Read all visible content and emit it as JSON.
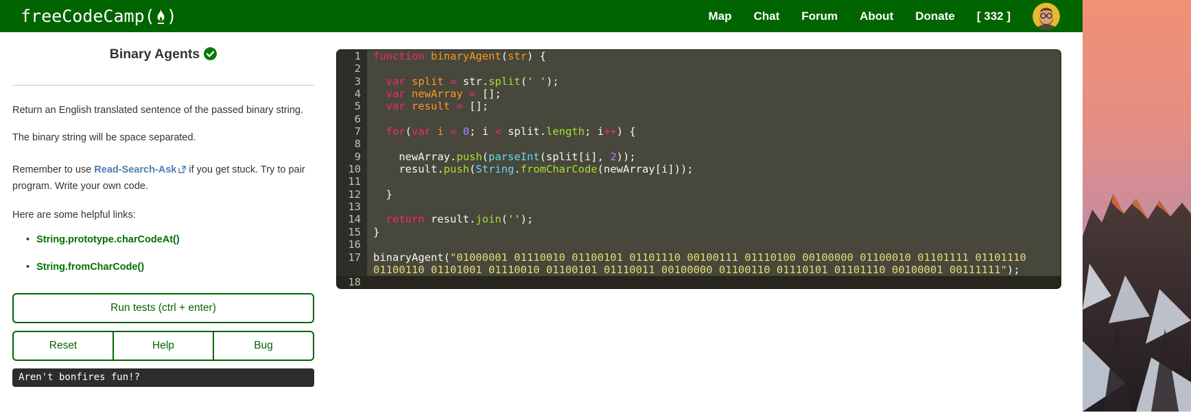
{
  "navbar": {
    "logo_text": "freeCodeCamp",
    "logo_paren_open": "(",
    "logo_paren_close": ")",
    "logo_icon": "flame-icon",
    "links": [
      "Map",
      "Chat",
      "Forum",
      "About",
      "Donate"
    ],
    "points_badge": "[ 332 ]",
    "background_color": "#006400"
  },
  "challenge": {
    "title": "Binary Agents",
    "completed_icon": "check-circle-icon",
    "description_1": "Return an English translated sentence of the passed binary string.",
    "description_2": "The binary string will be space separated.",
    "hint": {
      "before": "Remember to use ",
      "link": "Read-Search-Ask",
      "after": " if you get stuck. Try to pair program. Write your own code."
    },
    "helpful_heading": "Here are some helpful links:",
    "helpful_links": [
      "String.prototype.charCodeAt()",
      "String.fromCharCode()"
    ],
    "run_tests_label": "Run tests (ctrl + enter)",
    "secondary_buttons": [
      "Reset",
      "Help",
      "Bug"
    ],
    "output": "Aren't bonfires fun!?",
    "accent_green": "#006400",
    "link_blue": "#4a7fae",
    "link_green": "#007000"
  },
  "editor": {
    "colors": {
      "kw": "#f92672",
      "fn": "#fd971f",
      "str": "#e6db74",
      "num": "#ae81ff",
      "meth": "#a6e22e",
      "bi": "#66d9ef",
      "pl": "#f8f8f2",
      "background": "#47473c",
      "gutter": "#2e2e28"
    },
    "rows": [
      {
        "n": "1",
        "t": [
          [
            "kw",
            "function"
          ],
          [
            "pl",
            " "
          ],
          [
            "fn",
            "binaryAgent"
          ],
          [
            "pl",
            "("
          ],
          [
            "fn",
            "str"
          ],
          [
            "pl",
            ") {"
          ]
        ]
      },
      {
        "n": "2",
        "t": []
      },
      {
        "n": "3",
        "t": [
          [
            "pl",
            "  "
          ],
          [
            "kw",
            "var"
          ],
          [
            "pl",
            " "
          ],
          [
            "fn",
            "split"
          ],
          [
            "pl",
            " "
          ],
          [
            "kw",
            "="
          ],
          [
            "pl",
            " str."
          ],
          [
            "meth",
            "split"
          ],
          [
            "pl",
            "("
          ],
          [
            "str",
            "' '"
          ],
          [
            "pl",
            ");"
          ]
        ]
      },
      {
        "n": "4",
        "t": [
          [
            "pl",
            "  "
          ],
          [
            "kw",
            "var"
          ],
          [
            "pl",
            " "
          ],
          [
            "fn",
            "newArray"
          ],
          [
            "pl",
            " "
          ],
          [
            "kw",
            "="
          ],
          [
            "pl",
            " [];"
          ]
        ]
      },
      {
        "n": "5",
        "t": [
          [
            "pl",
            "  "
          ],
          [
            "kw",
            "var"
          ],
          [
            "pl",
            " "
          ],
          [
            "fn",
            "result"
          ],
          [
            "pl",
            " "
          ],
          [
            "kw",
            "="
          ],
          [
            "pl",
            " [];"
          ]
        ]
      },
      {
        "n": "6",
        "t": []
      },
      {
        "n": "7",
        "t": [
          [
            "pl",
            "  "
          ],
          [
            "kw",
            "for"
          ],
          [
            "pl",
            "("
          ],
          [
            "kw",
            "var"
          ],
          [
            "pl",
            " "
          ],
          [
            "fn",
            "i"
          ],
          [
            "pl",
            " "
          ],
          [
            "kw",
            "="
          ],
          [
            "pl",
            " "
          ],
          [
            "num",
            "0"
          ],
          [
            "pl",
            "; i "
          ],
          [
            "kw",
            "<"
          ],
          [
            "pl",
            " split."
          ],
          [
            "meth",
            "length"
          ],
          [
            "pl",
            "; i"
          ],
          [
            "kw",
            "++"
          ],
          [
            "pl",
            ") {"
          ]
        ]
      },
      {
        "n": "8",
        "t": []
      },
      {
        "n": "9",
        "t": [
          [
            "pl",
            "    newArray."
          ],
          [
            "meth",
            "push"
          ],
          [
            "pl",
            "("
          ],
          [
            "bi",
            "parseInt"
          ],
          [
            "pl",
            "(split[i], "
          ],
          [
            "num",
            "2"
          ],
          [
            "pl",
            "));"
          ]
        ]
      },
      {
        "n": "10",
        "t": [
          [
            "pl",
            "    result."
          ],
          [
            "meth",
            "push"
          ],
          [
            "pl",
            "("
          ],
          [
            "bi",
            "String"
          ],
          [
            "pl",
            "."
          ],
          [
            "meth",
            "fromCharCode"
          ],
          [
            "pl",
            "(newArray[i]));"
          ]
        ]
      },
      {
        "n": "11",
        "t": []
      },
      {
        "n": "12",
        "t": [
          [
            "pl",
            "  }"
          ]
        ]
      },
      {
        "n": "13",
        "t": []
      },
      {
        "n": "14",
        "t": [
          [
            "pl",
            "  "
          ],
          [
            "kw",
            "return"
          ],
          [
            "pl",
            " result."
          ],
          [
            "meth",
            "join"
          ],
          [
            "pl",
            "("
          ],
          [
            "str",
            "''"
          ],
          [
            "pl",
            ");"
          ]
        ]
      },
      {
        "n": "15",
        "t": [
          [
            "pl",
            "}"
          ]
        ]
      },
      {
        "n": "16",
        "t": []
      },
      {
        "n": "17",
        "t": [
          [
            "pl",
            "binaryAgent("
          ],
          [
            "str",
            "\"01000001 01110010 01100101 01101110 00100111 01110100 00100000 01100010 01101111 01101110"
          ]
        ]
      },
      {
        "n": "",
        "t": [
          [
            "str",
            "01100110 01101001 01110010 01100101 01110011 00100000 01100110 01110101 01101110 00100001 00111111\""
          ],
          [
            "pl",
            ");"
          ]
        ]
      },
      {
        "n": "18",
        "t": [],
        "dark": true
      }
    ]
  }
}
